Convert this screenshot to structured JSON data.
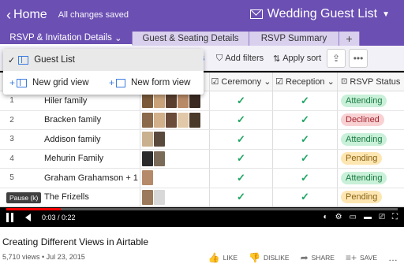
{
  "app": {
    "home_label": "Home",
    "save_status": "All changes saved",
    "base_name": "Wedding Guest List"
  },
  "tabs": [
    {
      "label": "RSVP & Invitation Details"
    },
    {
      "label": "Guest & Seating Details"
    },
    {
      "label": "RSVP Summary"
    },
    {
      "label": "+"
    }
  ],
  "toolbar": {
    "add_filters": "Add filters",
    "apply_sort": "Apply sort",
    "more": "•••"
  },
  "view_menu": {
    "selected": "Guest List",
    "new_grid": "New grid view",
    "new_form": "New form view"
  },
  "columns": {
    "ceremony": "Ceremony",
    "reception": "Reception",
    "rsvp_status": "RSVP Status"
  },
  "rows": [
    {
      "num": "1",
      "name": "Hiler family",
      "ceremony": "✓",
      "reception": "✓",
      "status": "Attending"
    },
    {
      "num": "2",
      "name": "Bracken family",
      "ceremony": "✓",
      "reception": "✓",
      "status": "Declined"
    },
    {
      "num": "3",
      "name": "Addison family",
      "ceremony": "✓",
      "reception": "✓",
      "status": "Attending"
    },
    {
      "num": "4",
      "name": "Mehurin Family",
      "ceremony": "✓",
      "reception": "✓",
      "status": "Pending"
    },
    {
      "num": "5",
      "name": "Graham Grahamson + 1",
      "ceremony": "✓",
      "reception": "✓",
      "status": "Attending"
    },
    {
      "num": "6",
      "name": "The Frizells",
      "ceremony": "✓",
      "reception": "✓",
      "status": "Pending"
    }
  ],
  "player": {
    "pause_tip": "Pause (k)",
    "time": "0:03 / 0:22",
    "progress": 0.14
  },
  "video": {
    "title": "Creating Different Views in Airtable",
    "meta": "5,710 views • Jul 23, 2015"
  },
  "actions": {
    "like": "LIKE",
    "dislike": "DISLIKE",
    "share": "SHARE",
    "save": "SAVE"
  },
  "colors": {
    "purple": "#6b4fb3",
    "attending": "#c9f0d8",
    "declined": "#f8d1d3",
    "pending": "#fde6b2",
    "check": "#1ea562"
  }
}
